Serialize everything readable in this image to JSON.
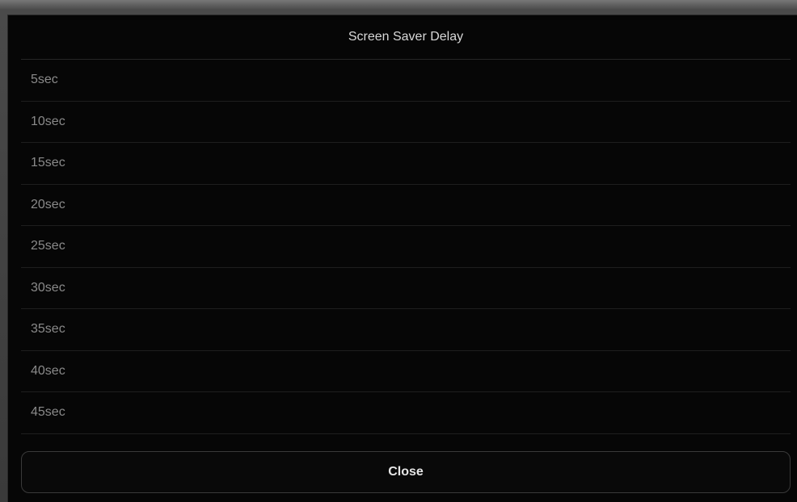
{
  "dialog": {
    "title": "Screen Saver Delay",
    "options": [
      {
        "label": "5sec"
      },
      {
        "label": "10sec"
      },
      {
        "label": "15sec"
      },
      {
        "label": "20sec"
      },
      {
        "label": "25sec"
      },
      {
        "label": "30sec"
      },
      {
        "label": "35sec"
      },
      {
        "label": "40sec"
      },
      {
        "label": "45sec"
      }
    ],
    "close_label": "Close"
  },
  "colors": {
    "background": "#060606",
    "option_text": "#8a8a8a",
    "title_text": "#d8d8d8",
    "close_text": "#e6e6e6"
  }
}
